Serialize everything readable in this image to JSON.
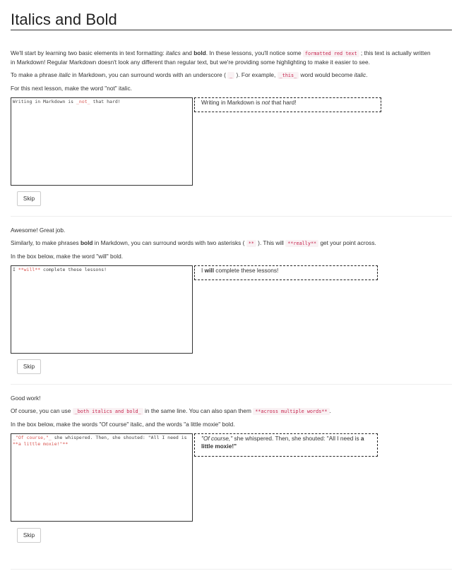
{
  "page": {
    "title": "Italics and Bold"
  },
  "lesson1": {
    "intro_part1": "We'll start by learning two basic elements in text formatting: ",
    "intro_italics": "italics",
    "intro_and": " and ",
    "intro_bold": "bold",
    "intro_part2": ". In these lessons, you'll notice some ",
    "intro_code": "formatted red text",
    "intro_part3": " ; this text is actually written",
    "intro_line2": "in Markdown! Regular Markdown doesn't look any different than regular text, but we're providing some highlighting to make it easier to see.",
    "howto_part1": "To make a phrase ",
    "howto_italic": "italic",
    "howto_part2": " in Markdown, you can surround words with an underscore ( ",
    "howto_code1": "_",
    "howto_part3": " ). For example, ",
    "howto_code2": "_this_",
    "howto_part4": " word would become ",
    "howto_italic2": "italic",
    "howto_part5": ".",
    "task": "For this next lesson, make the word \"not\" italic.",
    "editor_pre": "Writing in Markdown is ",
    "editor_red": "_not_",
    "editor_post": " that hard!",
    "preview_pre": "Writing in Markdown is ",
    "preview_em": "not",
    "preview_post": " that hard!",
    "qmark": "?",
    "skip_label": "Skip"
  },
  "lesson2": {
    "feedback": "Awesome! Great job.",
    "howto_part1": "Similarly, to make phrases ",
    "howto_bold": "bold",
    "howto_part2": " in Markdown, you can surround words with two asterisks ( ",
    "howto_code1": "**",
    "howto_part3": " ). This will ",
    "howto_code2": "**really**",
    "howto_part4": " get your point across.",
    "task": "In the box below, make the word \"will\" bold.",
    "editor_pre": "I ",
    "editor_red": "**will**",
    "editor_post": " complete these lessons!",
    "preview_pre": "I ",
    "preview_bold": "will",
    "preview_post": " complete these lessons!",
    "skip_label": "Skip"
  },
  "lesson3": {
    "feedback": "Good work!",
    "howto_part1": "Of course, you can use ",
    "howto_code1": "_both italics and bold_",
    "howto_part2": " in the same line. You can also span them ",
    "howto_code2": "**across multiple words**",
    "howto_part3": ".",
    "task": "In the box below, make the words \"Of course\" italic, and the words \"a little moxie\" bold.",
    "editor_red1": "_\"Of course,\"_",
    "editor_mid": " she whispered. Then, she shouted: \"All I need is ",
    "editor_red2": "**a little moxie!\"**",
    "preview_em": "\"Of course,\"",
    "preview_mid": " she whispered. Then, she shouted: \"All I need is ",
    "preview_bold": "a little moxie!\"",
    "skip_label": "Skip"
  }
}
